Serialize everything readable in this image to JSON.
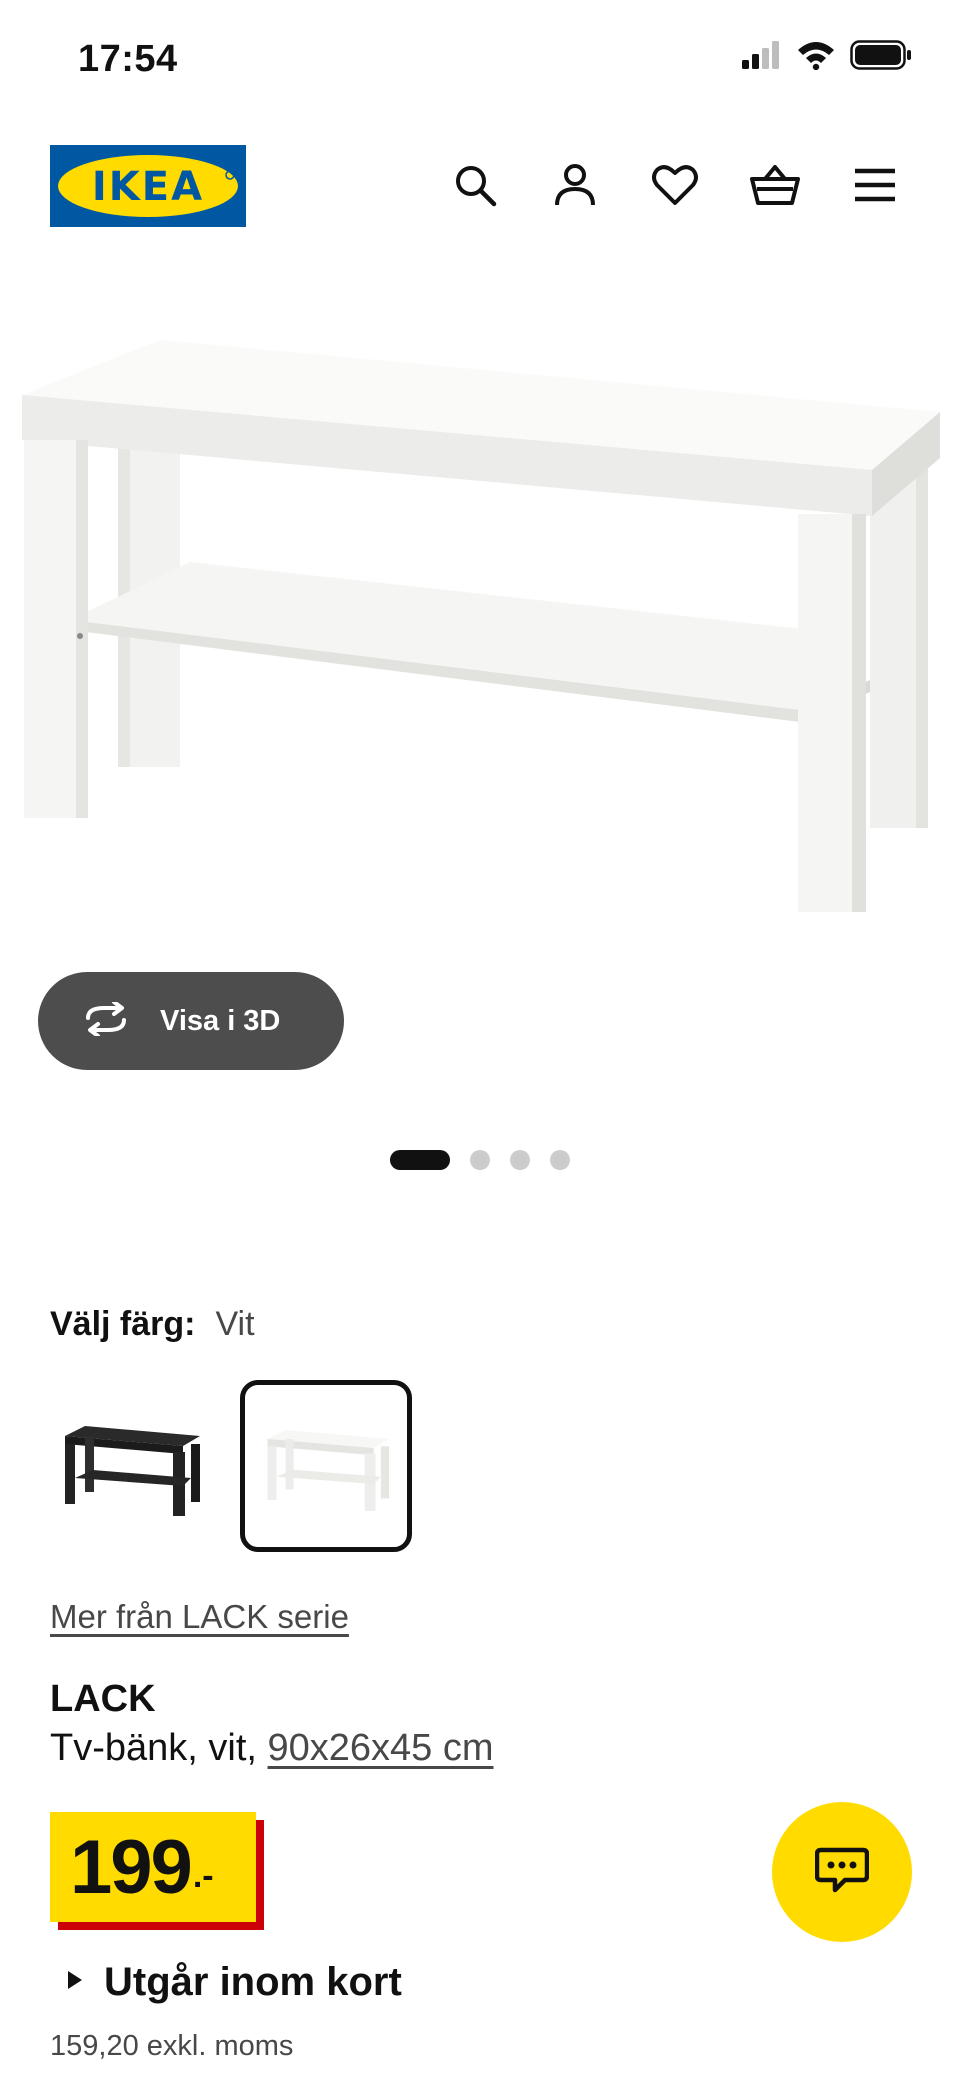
{
  "status_bar": {
    "time": "17:54",
    "icons": [
      "cellular-signal-icon",
      "wifi-icon",
      "battery-icon"
    ]
  },
  "header": {
    "logo_text": "IKEA",
    "nav_icons": [
      "search-icon",
      "account-icon",
      "heart-icon",
      "shopping-basket-icon",
      "menu-icon"
    ]
  },
  "gallery": {
    "visa_3d_label": "Visa i 3D",
    "image_count": 4,
    "active_index": 0
  },
  "color_picker": {
    "label": "Välj färg:",
    "selected_value": "Vit",
    "options": [
      "black-tv-bench",
      "white-tv-bench"
    ]
  },
  "product": {
    "series_link": "Mer från LACK serie",
    "name": "LACK",
    "description_prefix": "Tv-bänk, vit, ",
    "dimensions": "90x26x45 cm",
    "price_main": "199",
    "price_suffix": ".-",
    "availability": "Utgår inom kort",
    "price_excl_vat": "159,20 exkl. moms"
  },
  "colors": {
    "ikea_blue": "#0058a3",
    "ikea_yellow": "#ffdb00",
    "price_red": "#cc0008"
  }
}
